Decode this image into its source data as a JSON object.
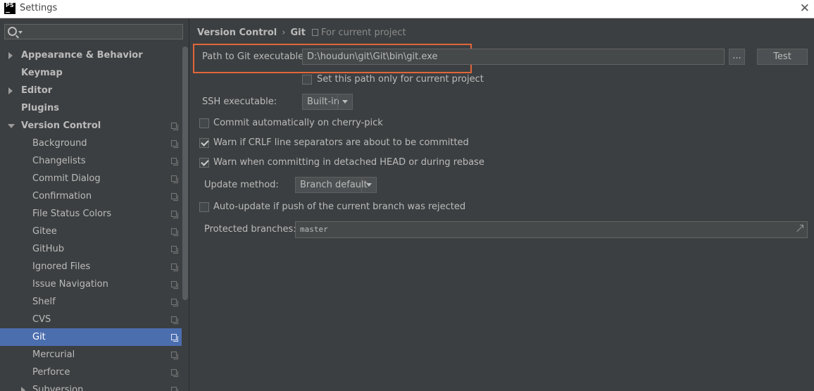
{
  "window": {
    "title": "Settings",
    "app_logo_text": "PS"
  },
  "search": {
    "placeholder": ""
  },
  "sidebar": {
    "items": [
      {
        "label": "Appearance & Behavior"
      },
      {
        "label": "Keymap"
      },
      {
        "label": "Editor"
      },
      {
        "label": "Plugins"
      },
      {
        "label": "Version Control"
      },
      {
        "label": "Background"
      },
      {
        "label": "Changelists"
      },
      {
        "label": "Commit Dialog"
      },
      {
        "label": "Confirmation"
      },
      {
        "label": "File Status Colors"
      },
      {
        "label": "Gitee"
      },
      {
        "label": "GitHub"
      },
      {
        "label": "Ignored Files"
      },
      {
        "label": "Issue Navigation"
      },
      {
        "label": "Shelf"
      },
      {
        "label": "CVS"
      },
      {
        "label": "Git"
      },
      {
        "label": "Mercurial"
      },
      {
        "label": "Perforce"
      },
      {
        "label": "Subversion"
      }
    ]
  },
  "breadcrumb": {
    "parent": "Version Control",
    "separator": "›",
    "current": "Git"
  },
  "scope_note": "For current project",
  "git": {
    "path_label": "Path to Git executable:",
    "path_value": "D:\\houdun\\git\\Git\\bin\\git.exe",
    "browse_label": "...",
    "test_label": "Test",
    "path_only_current_label": "Set this path only for current project",
    "ssh_label": "SSH executable:",
    "ssh_value": "Built-in",
    "commit_cherry_pick_label": "Commit automatically on cherry-pick",
    "warn_crlf_label": "Warn if CRLF line separators are about to be committed",
    "warn_detached_label": "Warn when committing in detached HEAD or during rebase",
    "update_method_label": "Update method:",
    "update_method_value": "Branch default",
    "auto_update_label": "Auto-update if push of the current branch was rejected",
    "protected_label": "Protected branches:",
    "protected_value": "master"
  },
  "colors": {
    "selection": "#4b6eaf",
    "highlight_border": "#e0663a",
    "background": "#3c3f41"
  }
}
